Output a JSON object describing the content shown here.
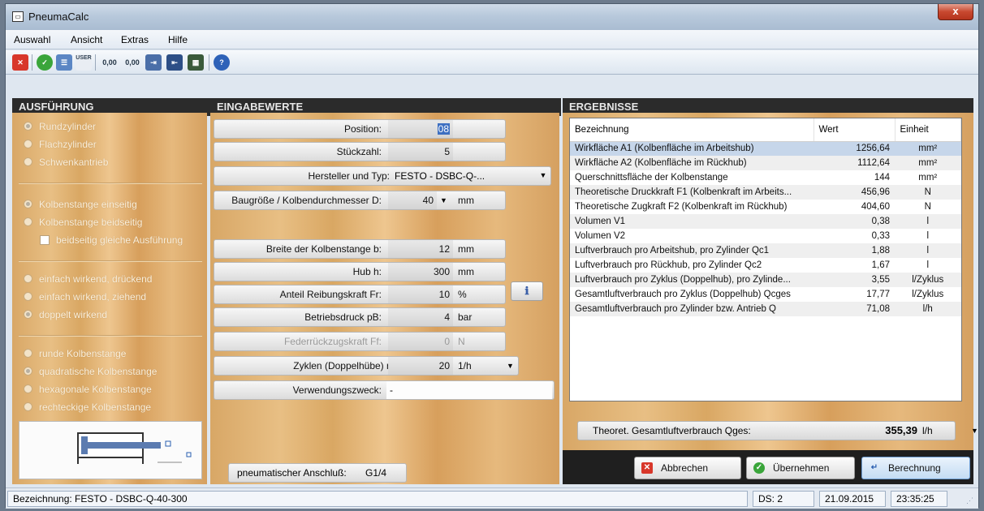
{
  "window": {
    "title": "PneumaCalc",
    "close_label": "x"
  },
  "menu": [
    "Auswahl",
    "Ansicht",
    "Extras",
    "Hilfe"
  ],
  "toolbar": {
    "user_label": "USER",
    "decimal1": "0,00",
    "decimal2": "0,00"
  },
  "left": {
    "header": "AUSFÜHRUNG",
    "group1": [
      {
        "label": "Rundzylinder",
        "selected": true
      },
      {
        "label": "Flachzylinder",
        "selected": false
      },
      {
        "label": "Schwenkantrieb",
        "selected": false
      }
    ],
    "group2": [
      {
        "label": "Kolbenstange einseitig",
        "selected": true
      },
      {
        "label": "Kolbenstange beidseitig",
        "selected": false
      }
    ],
    "checkbox_label": "beidseitig gleiche Ausführung",
    "group3": [
      {
        "label": "einfach wirkend, drückend",
        "selected": false
      },
      {
        "label": "einfach wirkend, ziehend",
        "selected": false
      },
      {
        "label": "doppelt wirkend",
        "selected": true
      }
    ],
    "group4": [
      {
        "label": "runde Kolbenstange",
        "selected": false
      },
      {
        "label": "quadratische Kolbenstange",
        "selected": true
      },
      {
        "label": "hexagonale Kolbenstange",
        "selected": false
      },
      {
        "label": "rechteckige Kolbenstange",
        "selected": false
      }
    ]
  },
  "mid": {
    "header": "EINGABEWERTE",
    "position": {
      "label": "Position:",
      "value": "08"
    },
    "count": {
      "label": "Stückzahl:",
      "value": "5"
    },
    "manufacturer": {
      "label": "Hersteller und Typ:",
      "value": "FESTO - DSBC-Q-..."
    },
    "size": {
      "label": "Baugröße / Kolbendurchmesser D:",
      "value": "40",
      "unit": "mm"
    },
    "rod_width": {
      "label": "Breite der Kolbenstange b:",
      "value": "12",
      "unit": "mm"
    },
    "stroke": {
      "label": "Hub h:",
      "value": "300",
      "unit": "mm"
    },
    "friction": {
      "label": "Anteil Reibungskraft Fr:",
      "value": "10",
      "unit": "%"
    },
    "pressure": {
      "label": "Betriebsdruck pB:",
      "value": "4",
      "unit": "bar"
    },
    "spring": {
      "label": "Federrückzugskraft Ff:",
      "value": "0",
      "unit": "N"
    },
    "cycles": {
      "label": "Zyklen (Doppelhübe) n:",
      "value": "20",
      "unit": "1/h"
    },
    "purpose": {
      "label": "Verwendungszweck:",
      "value": "-"
    },
    "connection": {
      "label": "pneumatischer Anschluß:",
      "value": "G1/4"
    }
  },
  "right": {
    "header": "ERGEBNISSE",
    "columns": [
      "Bezeichnung",
      "Wert",
      "Einheit"
    ],
    "rows": [
      [
        "Wirkfläche A1 (Kolbenfläche im Arbeitshub)",
        "1256,64",
        "mm²"
      ],
      [
        "Wirkfläche A2 (Kolbenfläche im Rückhub)",
        "1112,64",
        "mm²"
      ],
      [
        "Querschnittsfläche der Kolbenstange",
        "144",
        "mm²"
      ],
      [
        "Theoretische Druckkraft F1 (Kolbenkraft im Arbeits...",
        "456,96",
        "N"
      ],
      [
        "Theoretische Zugkraft F2 (Kolbenkraft im Rückhub)",
        "404,60",
        "N"
      ],
      [
        "Volumen V1",
        "0,38",
        "l"
      ],
      [
        "Volumen V2",
        "0,33",
        "l"
      ],
      [
        "Luftverbrauch pro Arbeitshub, pro Zylinder Qc1",
        "1,88",
        "l"
      ],
      [
        "Luftverbrauch pro Rückhub, pro Zylinder Qc2",
        "1,67",
        "l"
      ],
      [
        "Luftverbrauch pro Zyklus (Doppelhub), pro Zylinde...",
        "3,55",
        "l/Zyklus"
      ],
      [
        "Gesamtluftverbrauch pro Zyklus (Doppelhub) Qcges",
        "17,77",
        "l/Zyklus"
      ],
      [
        "Gesamtluftverbrauch pro Zylinder bzw. Antrieb Q",
        "71,08",
        "l/h"
      ]
    ],
    "total": {
      "label": "Theoret. Gesamtluftverbrauch Qges:",
      "value": "355,39",
      "unit": "l/h"
    },
    "buttons": {
      "cancel": "Abbrechen",
      "accept": "Übernehmen",
      "calc": "Berechnung"
    }
  },
  "status": {
    "description": "Bezeichnung:  FESTO - DSBC-Q-40-300",
    "ds": "DS: 2",
    "date": "21.09.2015",
    "time": "23:35:25"
  }
}
